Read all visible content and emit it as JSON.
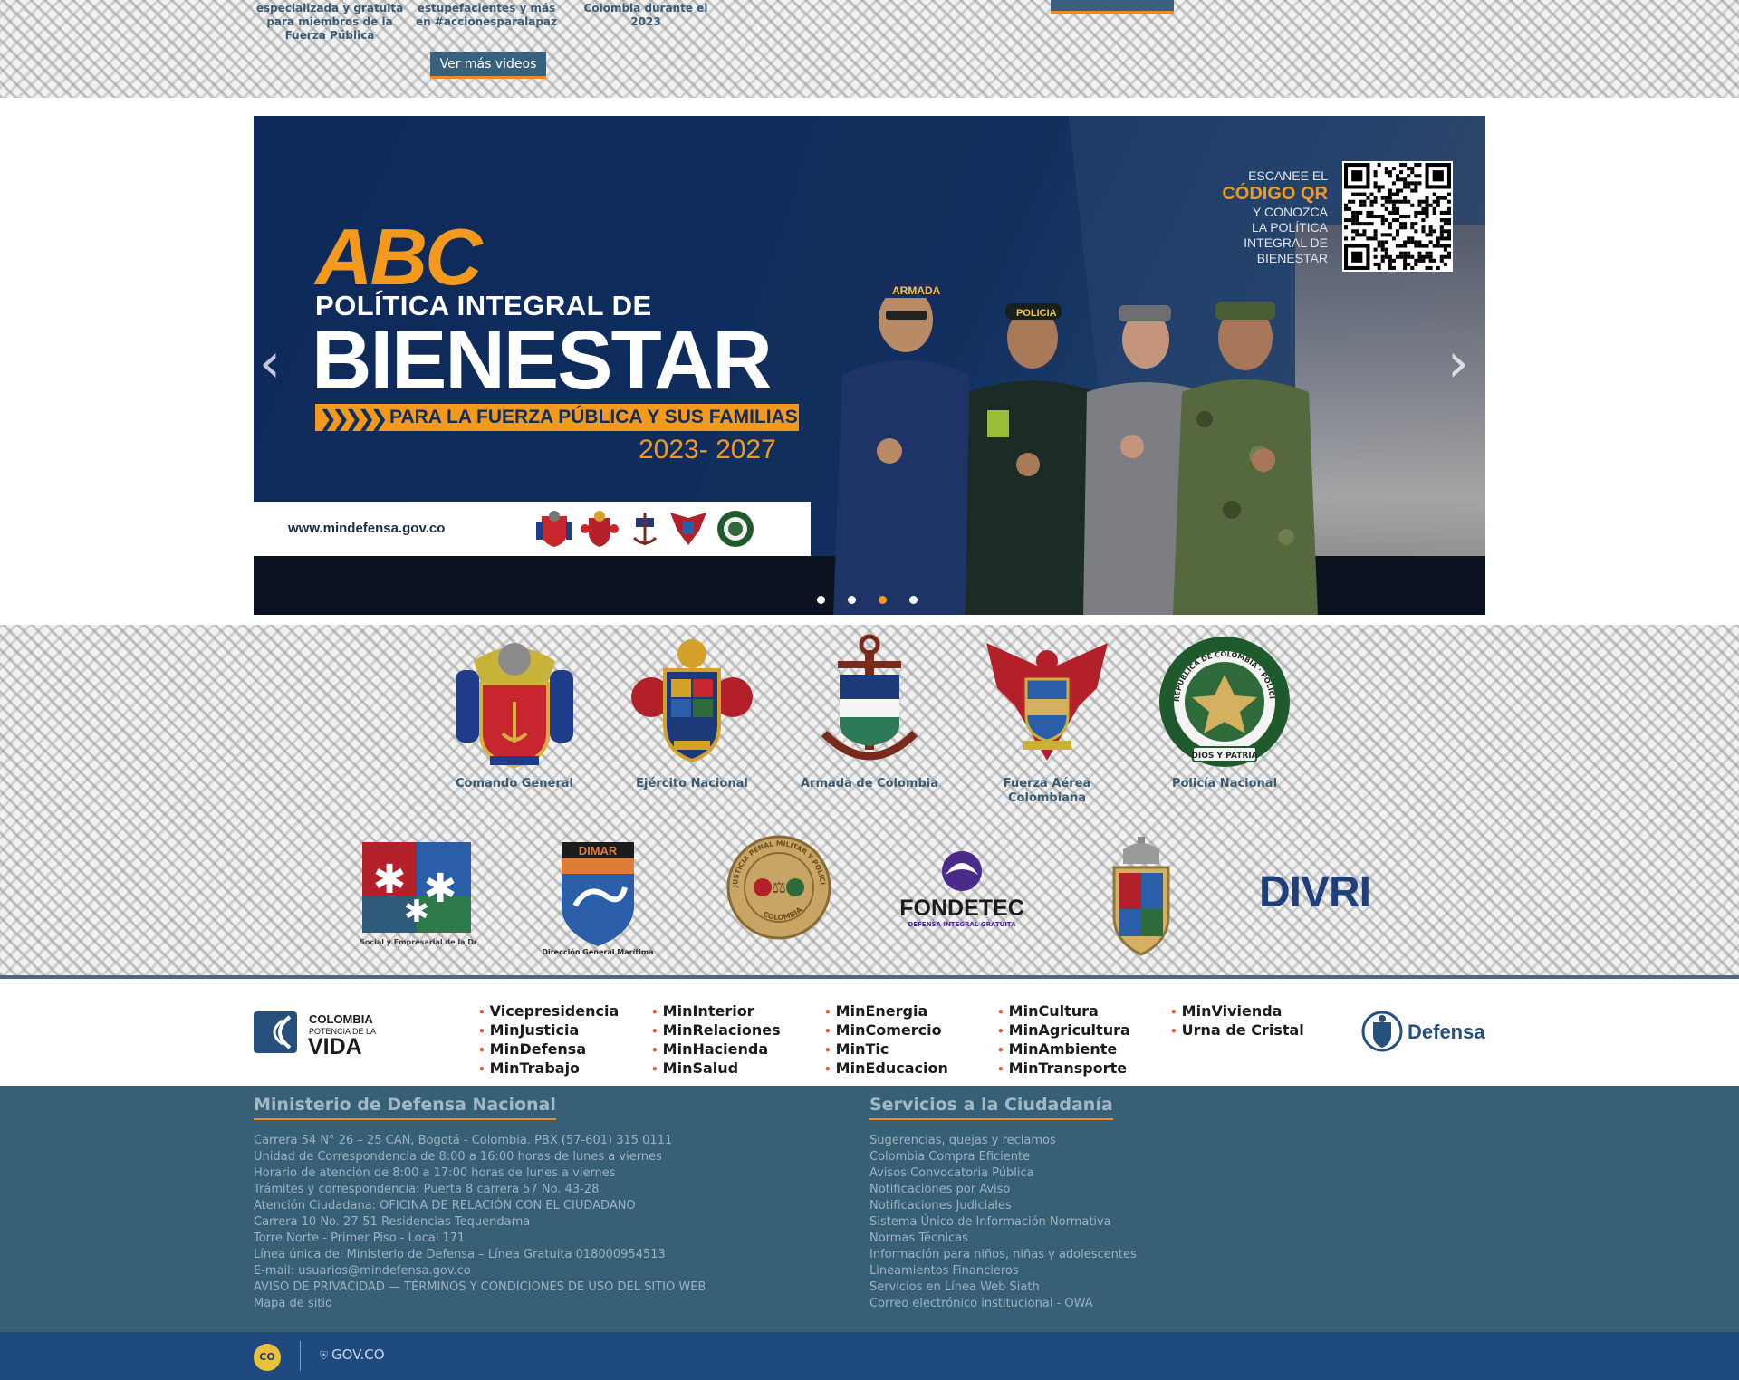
{
  "top_strip": {
    "captions": [
      "especializada y gratuita para miembros de la Fuerza Pública",
      "estupefacientes y más en #accionesparalapaz",
      "Colombia durante el 2023"
    ],
    "more_videos_label": "Ver más videos"
  },
  "banner": {
    "abc": "ABC",
    "line1": "POLÍTICA INTEGRAL DE",
    "line2": "BIENESTAR",
    "line3": "PARA LA FUERZA PÚBLICA Y SUS FAMILIAS",
    "years": "2023- 2027",
    "url": "www.mindefensa.gov.co",
    "qr_line1": "ESCANEE EL",
    "qr_highlight": "CÓDIGO QR",
    "qr_line2": "Y CONOZCA",
    "qr_line3": "LA POLÍTICA",
    "qr_line4": "INTEGRAL DE",
    "qr_line5": "BIENESTAR",
    "slides_total": 4,
    "slide_active": 3,
    "soldier_caps": [
      "ARMADA",
      "POLICIA",
      "",
      ""
    ],
    "colors": {
      "navy": "#0f2d5e",
      "orange": "#f39a1e"
    }
  },
  "crests": [
    {
      "label": "Comando General"
    },
    {
      "label": "Ejército Nacional"
    },
    {
      "label": "Armada de Colombia"
    },
    {
      "label": "Fuerza Aérea Colombiana"
    },
    {
      "label": "Policía Nacional"
    }
  ],
  "policia_seal_text": "REPÚBLICA DE COLOMBIA · POLICÍA NACIONAL",
  "policia_motto": "DIOS Y PATRIA",
  "entities": {
    "gsed_caption": "Grupo Social y Empresarial de la Defensa",
    "dimar_name": "DIMAR",
    "dimar_caption": "Dirección General Marítima",
    "justicia_ring": "JUSTICIA PENAL MILITAR Y POLICIAL",
    "justicia_bottom": "COLOMBIA",
    "fondetec_name": "FONDETEC",
    "fondetec_caption": "DEFENSA INTEGRAL GRATUITA",
    "divri": "DIVRI"
  },
  "ministries": {
    "logo_line1": "COLOMBIA",
    "logo_line2": "POTENCIA DE LA",
    "logo_line3": "VIDA",
    "col1": [
      "Vicepresidencia",
      "MinJusticia",
      "MinDefensa",
      "MinTrabajo"
    ],
    "col2": [
      "MinInterior",
      "MinRelaciones",
      "MinHacienda",
      "MinSalud"
    ],
    "col3": [
      "MinEnergia",
      "MinComercio",
      "MinTic",
      "MinEducacion"
    ],
    "col4": [
      "MinCultura",
      "MinAgricultura",
      "MinAmbiente",
      "MinTransporte"
    ],
    "col5": [
      "MinVivienda",
      "Urna de Cristal"
    ],
    "defensa_label": "Defensa"
  },
  "footer": {
    "left_title": "Ministerio de Defensa Nacional",
    "left_items": [
      "Carrera 54 N° 26 – 25 CAN, Bogotá - Colombia. PBX (57-601) 315 0111",
      "Unidad de Correspondencia de 8:00 a 16:00 horas de lunes a viernes",
      "Horario de atención de 8:00 a 17:00 horas de lunes a viernes",
      "Trámites y correspondencia: Puerta 8 carrera 57 No. 43-28",
      "Atención Ciudadana: OFICINA DE RELACIÓN CON EL CIUDADANO",
      "Carrera 10 No. 27-51 Residencias Tequendama",
      "Torre Norte - Primer Piso - Local 171",
      "Línea única del Ministerio de Defensa – Línea Gratuita 018000954513",
      "E-mail: usuarios@mindefensa.gov.co",
      "AVISO DE PRIVACIDAD — TÉRMINOS Y CONDICIONES DE USO DEL SITIO WEB",
      "Mapa de sitio"
    ],
    "right_title": "Servicios a la Ciudadanía",
    "right_items": [
      "Sugerencias, quejas y reclamos",
      "Colombia Compra Eficiente",
      "Avisos Convocatoria Pública",
      "Notificaciones por Aviso",
      "Notificaciones Judiciales",
      "Sistema Único de Información Normativa",
      "Normas Técnicas",
      "Información para niños, niñas y adolescentes",
      "Lineamientos Financieros",
      "Servicios en Línea Web Siath",
      "Correo electrónico institucional - OWA"
    ],
    "co_logo": "CO",
    "gov_co": "GOV.CO"
  }
}
